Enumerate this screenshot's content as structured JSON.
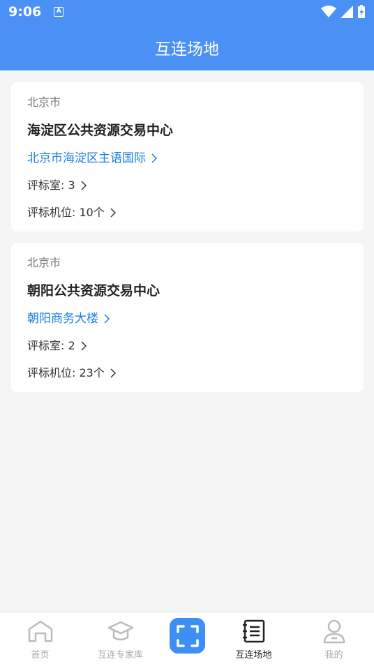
{
  "status": {
    "time": "9:06",
    "app_badge": "A"
  },
  "header": {
    "title": "互连场地"
  },
  "venues": [
    {
      "city": "北京市",
      "name": "海淀区公共资源交易中心",
      "address": "北京市海淀区主语国际",
      "rooms_label": "评标室: 3",
      "seats_label": "评标机位: 10个"
    },
    {
      "city": "北京市",
      "name": "朝阳公共资源交易中心",
      "address": "朝阳商务大楼",
      "rooms_label": "评标室: 2",
      "seats_label": "评标机位: 23个"
    }
  ],
  "tabs": [
    {
      "label": "首页",
      "icon": "home-icon",
      "active": false
    },
    {
      "label": "互连专家库",
      "icon": "graduation-cap-icon",
      "active": false
    },
    {
      "label": "",
      "icon": "scan-icon",
      "active": false
    },
    {
      "label": "互连场地",
      "icon": "notebook-icon",
      "active": true
    },
    {
      "label": "我的",
      "icon": "user-icon",
      "active": false
    }
  ],
  "colors": {
    "primary": "#4a90f5",
    "link": "#1a7fe0",
    "background": "#f5f5f5"
  }
}
